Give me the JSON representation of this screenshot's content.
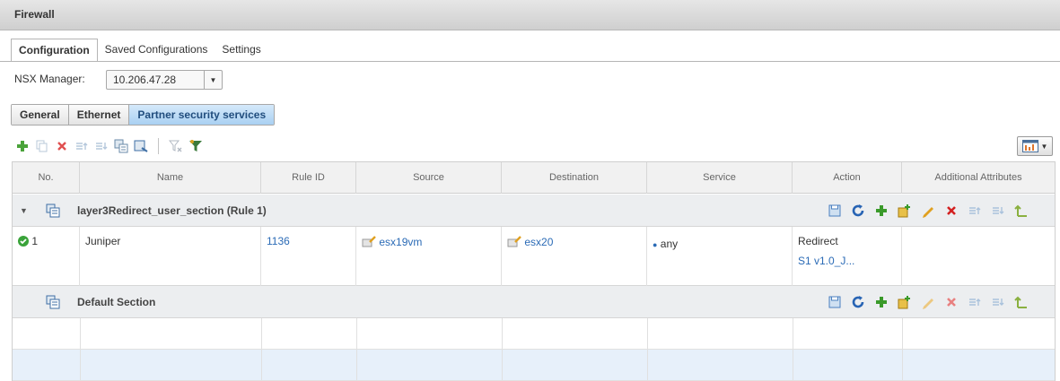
{
  "window": {
    "title": "Firewall"
  },
  "tabs": [
    {
      "label": "Configuration"
    },
    {
      "label": "Saved Configurations"
    },
    {
      "label": "Settings"
    }
  ],
  "nsx_manager": {
    "label": "NSX Manager:",
    "value": "10.206.47.28"
  },
  "subtabs": [
    {
      "label": "General"
    },
    {
      "label": "Ethernet"
    },
    {
      "label": "Partner security services"
    }
  ],
  "toolbar": {
    "icons": [
      "add-rule-icon",
      "copy-rule-icon",
      "delete-rule-icon",
      "move-up-icon",
      "move-down-icon",
      "copy-section-icon",
      "add-section-icon",
      "clear-filter-icon",
      "filter-icon"
    ],
    "view_icon": "column-chart-icon"
  },
  "grid": {
    "columns": [
      "No.",
      "Name",
      "Rule ID",
      "Source",
      "Destination",
      "Service",
      "Action",
      "Additional Attributes"
    ],
    "sections": [
      {
        "name": "layer3Redirect_user_section (Rule 1)",
        "rules": [
          {
            "no": "1",
            "name": "Juniper",
            "rule_id": "1136",
            "source": "esx19vm",
            "destination": "esx20",
            "service": "any",
            "action": "Redirect",
            "action_profile": "S1 v1.0_J..."
          }
        ]
      },
      {
        "name": "Default Section",
        "rules": []
      }
    ]
  },
  "colors": {
    "accent_blue": "#2b6bb6",
    "enabled_green": "#3aa33a",
    "delete_red": "#d32020",
    "header_bg": "#f1f1f1",
    "section_bg": "#eceef0"
  }
}
